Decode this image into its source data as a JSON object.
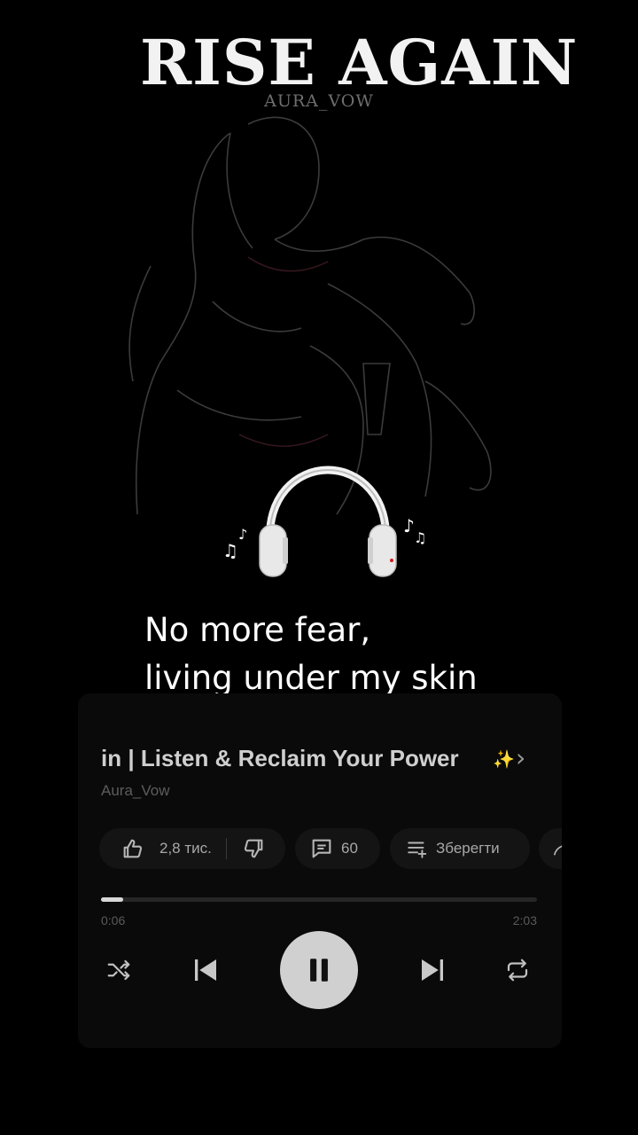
{
  "cover": {
    "title": "RISE AGAIN",
    "artist": "AURA_VOW"
  },
  "lyrics": {
    "line1": "No more fear,",
    "line2": "living under my skin"
  },
  "player": {
    "track_title": "in | Listen & Reclaim Your Power",
    "track_artist": "Aura_Vow",
    "likes": "2,8 тис.",
    "comments": "60",
    "save_label": "Зберегти",
    "current_time": "0:06",
    "total_time": "2:03",
    "progress": 0.05,
    "state": "playing"
  },
  "icons": {
    "like": "thumbs-up-icon",
    "dislike": "thumbs-down-icon",
    "comments": "comment-icon",
    "save": "playlist-add-icon",
    "shuffle": "shuffle-icon",
    "prev": "skip-previous-icon",
    "pause": "pause-icon",
    "next": "skip-next-icon",
    "repeat": "repeat-icon",
    "chevron": "chevron-right-icon",
    "headphones": "headphones-icon",
    "music_notes": "music-notes-icon"
  },
  "colors": {
    "background": "#000000",
    "panel": "#0a0a0a",
    "pill": "#141414",
    "text_primary": "#ffffff",
    "text_muted": "#5c5c5c",
    "play_button": "#d0d0d0"
  }
}
